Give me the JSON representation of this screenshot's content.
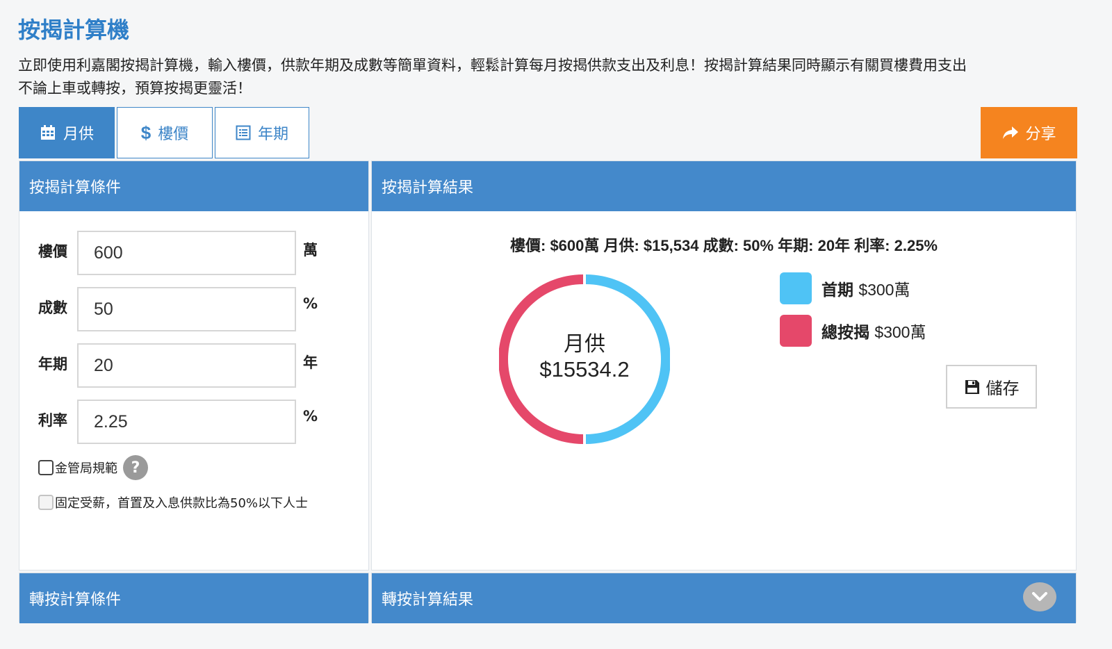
{
  "page": {
    "title": "按揭計算機",
    "intro_line1": "立即使用利嘉閣按揭計算機，輸入樓價，供款年期及成數等簡單資料，輕鬆計算每月按揭供款支出及利息！按揭計算結果同時顯示有關買樓費用支出",
    "intro_line2": "不論上車或轉按，預算按揭更靈活！"
  },
  "tabs": [
    {
      "label": "月供",
      "icon": "calendar-icon",
      "active": true
    },
    {
      "label": "樓價",
      "icon": "dollar-icon",
      "active": false
    },
    {
      "label": "年期",
      "icon": "list-icon",
      "active": false
    }
  ],
  "share": {
    "label": "分享",
    "icon": "share-arrow-icon"
  },
  "conditions": {
    "header": "按揭計算條件",
    "fields": [
      {
        "label": "樓價",
        "value": "600",
        "unit": "萬"
      },
      {
        "label": "成數",
        "value": "50",
        "unit": "%"
      },
      {
        "label": "年期",
        "value": "20",
        "unit": "年"
      },
      {
        "label": "利率",
        "value": "2.25",
        "unit": "%"
      }
    ],
    "checkbox_hkma": "金管局規範",
    "checkbox_fixed_income": "固定受薪，首置及入息供款比為50%以下人士"
  },
  "results": {
    "header": "按揭計算結果",
    "summary": "樓價: $600萬 月供: $15,534 成數: 50% 年期: 20年 利率: 2.25%",
    "donut_label": "月供",
    "donut_value": "$15534.2",
    "legend": [
      {
        "label": "首期",
        "amount": "$300萬",
        "color": "#4fc3f5",
        "value": 300
      },
      {
        "label": "總按揭",
        "amount": "$300萬",
        "color": "#e5486a",
        "value": 300
      }
    ],
    "save_label": "儲存"
  },
  "refinance": {
    "conditions_header": "轉按計算條件",
    "results_header": "轉按計算結果"
  }
}
